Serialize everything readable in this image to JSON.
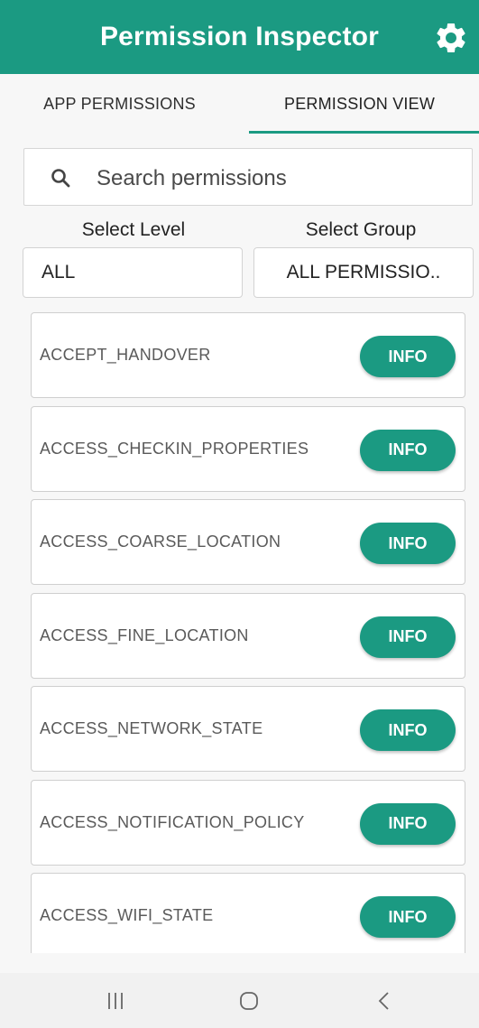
{
  "app": {
    "title": "Permission Inspector",
    "accent_color": "#1b9a82",
    "settings_icon": "gear-icon"
  },
  "tabs": [
    {
      "label": "APP PERMISSIONS",
      "selected": false
    },
    {
      "label": "PERMISSION VIEW",
      "selected": true
    }
  ],
  "search": {
    "placeholder": "Search permissions",
    "value": "",
    "icon": "search-icon"
  },
  "filters": {
    "level_label": "Select Level",
    "level_value": "ALL",
    "group_label": "Select Group",
    "group_value": "ALL PERMISSIO.."
  },
  "permissions": [
    {
      "name": "ACCEPT_HANDOVER",
      "button": "INFO"
    },
    {
      "name": "ACCESS_CHECKIN_PROPERTIES",
      "button": "INFO"
    },
    {
      "name": "ACCESS_COARSE_LOCATION",
      "button": "INFO"
    },
    {
      "name": "ACCESS_FINE_LOCATION",
      "button": "INFO"
    },
    {
      "name": "ACCESS_NETWORK_STATE",
      "button": "INFO"
    },
    {
      "name": "ACCESS_NOTIFICATION_POLICY",
      "button": "INFO"
    },
    {
      "name": "ACCESS_WIFI_STATE",
      "button": "INFO"
    }
  ],
  "navbar": {
    "recents_icon": "recents-icon",
    "home_icon": "home-icon",
    "back_icon": "back-icon"
  }
}
